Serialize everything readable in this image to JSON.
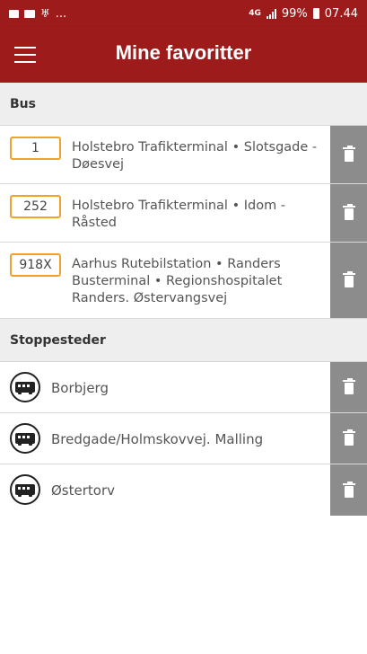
{
  "status_bar": {
    "left_more": "...",
    "network": "4G",
    "battery_level": "99%",
    "time": "07.44"
  },
  "app_bar": {
    "title": "Mine favoritter",
    "menu_icon": "hamburger-menu-icon"
  },
  "bus_section": {
    "title": "Bus",
    "routes": [
      {
        "number": "1",
        "description": "Holstebro Trafikterminal • Slotsgade - Døesvej"
      },
      {
        "number": "252",
        "description": "Holstebro Trafikterminal • Idom - Råsted"
      },
      {
        "number": "918X",
        "description": "Aarhus Rutebilstation • Randers Busterminal • Regionshospitalet Randers. Østervangsvej"
      }
    ]
  },
  "stops_section": {
    "title": "Stoppesteder",
    "stops": [
      {
        "name": "Borbjerg"
      },
      {
        "name": "Bredgade/Holmskovvej. Malling"
      },
      {
        "name": "Østertorv"
      }
    ]
  },
  "colors": {
    "brand": "#9e1b1c",
    "route_badge_border": "#f2a22c",
    "delete_button": "#8c8c8c",
    "section_header_bg": "#eeeeee"
  },
  "icons": {
    "delete": "trash-icon",
    "stop": "bus-stop-icon"
  }
}
